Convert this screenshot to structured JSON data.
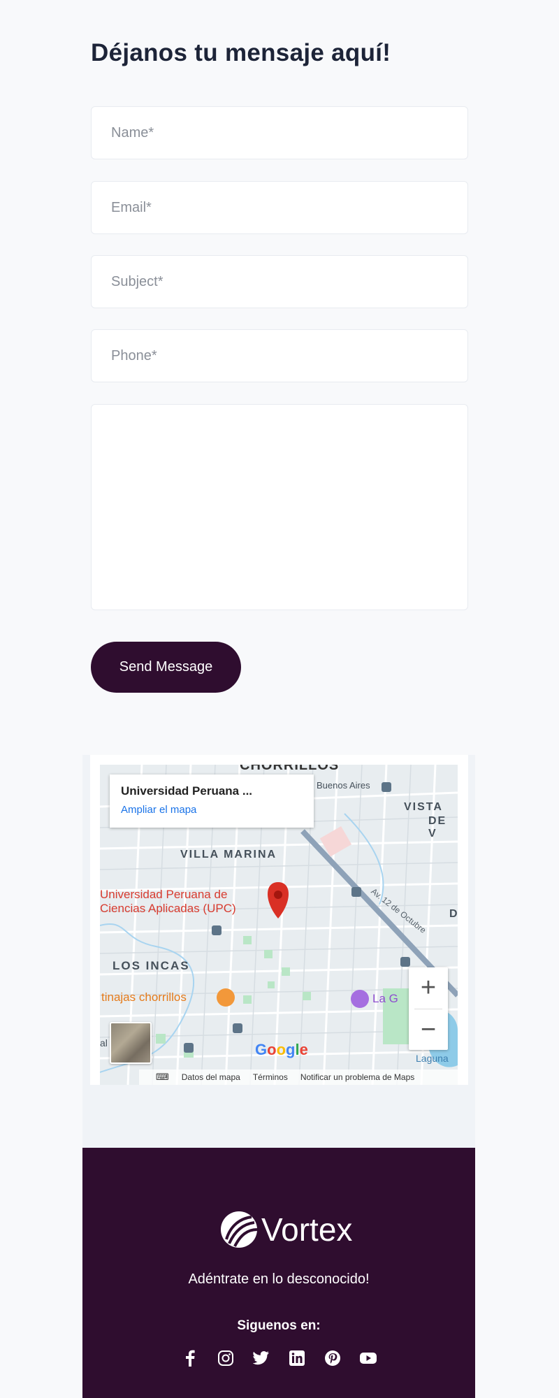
{
  "form": {
    "title": "Déjanos tu mensaje aquí!",
    "name_placeholder": "Name*",
    "email_placeholder": "Email*",
    "subject_placeholder": "Subject*",
    "phone_placeholder": "Phone*",
    "message_placeholder": "",
    "send_label": "Send Message"
  },
  "map": {
    "card_title": "Universidad Peruana ...",
    "card_link": "Ampliar el mapa",
    "labels": {
      "top": "CHORRILLOS",
      "buenos_aires": "Buenos Aires",
      "vista": "VISTA",
      "de": "DE V",
      "villa_marina": "VILLA MARINA",
      "los_incas": "LOS INCAS",
      "upc_line1": "Universidad Peruana de",
      "upc_line2": "Ciencias Aplicadas (UPC)",
      "road": "Av. 12 de Octubre",
      "tinajas": "tinajas chorrillos",
      "la_g": "La G",
      "laguna": "Laguna",
      "d": "D",
      "al": "al"
    },
    "google": "Google",
    "footer_items": [
      "Datos del mapa",
      "Términos",
      "Notificar un problema de Maps"
    ],
    "zoom_in": "+",
    "zoom_out": "−"
  },
  "footer": {
    "logo_text": "Vortex",
    "tagline": "Adéntrate en lo desconocido!",
    "follow_label": "Siguenos en:",
    "socials": [
      "facebook-icon",
      "instagram-icon",
      "twitter-icon",
      "linkedin-icon",
      "pinterest-icon",
      "youtube-icon"
    ]
  },
  "colors": {
    "brand": "#2f0d2f",
    "title": "#1d2438",
    "map_pin": "#d93025",
    "link": "#1a73e8"
  }
}
